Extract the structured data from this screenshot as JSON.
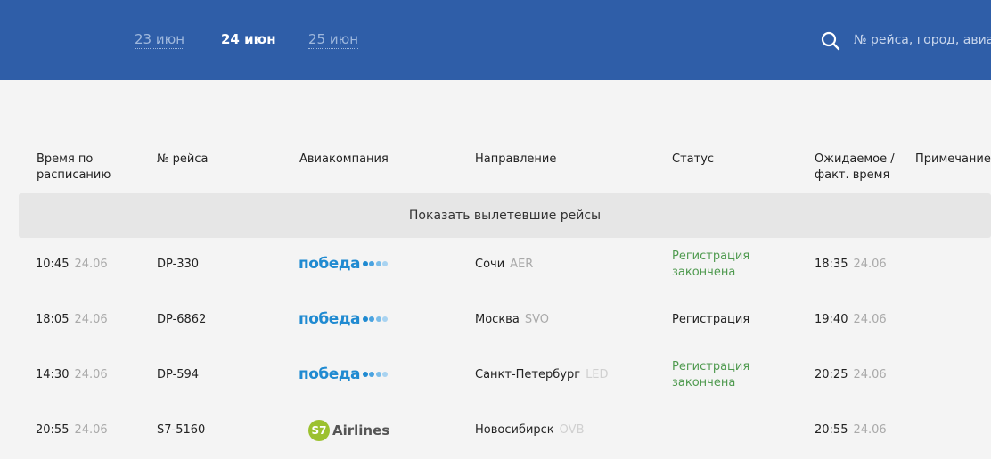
{
  "header": {
    "dates": [
      "23 июн",
      "24 июн",
      "25 июн"
    ],
    "active_date": "24 июн",
    "search": {
      "icon": "search-icon",
      "placeholder": "№ рейса, город, авиакомпания"
    }
  },
  "table": {
    "columns": {
      "scheduled_time": "Время по\nрасписанию",
      "flight_no": "№ рейса",
      "airline": "Авиакомпания",
      "destination": "Направление",
      "status": "Статус",
      "expected_time": "Ожидаемое /\nфакт. время",
      "note": "Примечание"
    },
    "show_departed_label": "Показать вылетевшие рейсы",
    "rows": [
      {
        "time": "10:45",
        "date": "24.06",
        "flight": "DP-330",
        "airline": {
          "name": "победа",
          "logo": "pobeda-logo"
        },
        "city": "Сочи",
        "code": "AER",
        "status": "Регистрация\nзакончена",
        "status_color": "#4f9a4f",
        "exp_time": "18:35",
        "exp_date": "24.06",
        "note": ""
      },
      {
        "time": "18:05",
        "date": "24.06",
        "flight": "DP-6862",
        "airline": {
          "name": "победа",
          "logo": "pobeda-logo"
        },
        "city": "Москва",
        "code": "SVO",
        "status": "Регистрация",
        "status_color": "#222222",
        "exp_time": "19:40",
        "exp_date": "24.06",
        "note": ""
      },
      {
        "time": "14:30",
        "date": "24.06",
        "flight": "DP-594",
        "airline": {
          "name": "победа",
          "logo": "pobeda-logo"
        },
        "city": "Санкт-Петербург",
        "code": "LED",
        "status": "Регистрация\nзакончена",
        "status_color": "#4f9a4f",
        "exp_time": "20:25",
        "exp_date": "24.06",
        "note": ""
      },
      {
        "time": "20:55",
        "date": "24.06",
        "flight": "S7-5160",
        "airline": {
          "name": "Airlines",
          "badge": "S7",
          "logo": "s7-logo"
        },
        "city": "Новосибирск",
        "code": "OVB",
        "status": "",
        "status_color": "#222222",
        "exp_time": "20:55",
        "exp_date": "24.06",
        "note": ""
      }
    ]
  },
  "colors": {
    "header_bg": "#2f5ea8",
    "pobeda_blue": "#1f8ad1",
    "pobeda_dots": [
      "#1f8ad1",
      "#4aa3e0",
      "#7bbde9",
      "#a8d3f1"
    ],
    "s7_green": "#9cc12f",
    "status_green": "#4f9a4f"
  }
}
